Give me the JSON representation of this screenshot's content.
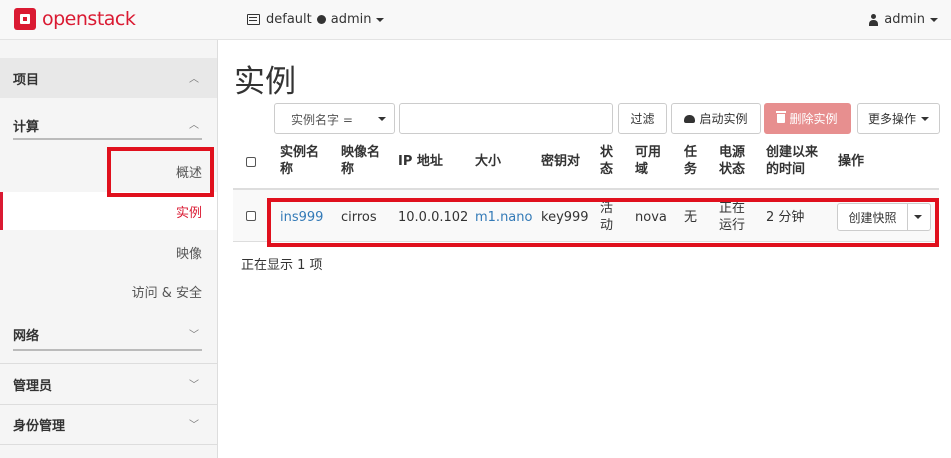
{
  "topbar": {
    "brand": "openstack",
    "domain": "default",
    "project": "admin",
    "user": "admin"
  },
  "sidebar": {
    "project": "项目",
    "compute": "计算",
    "items": [
      "概述",
      "实例",
      "映像",
      "访问 & 安全"
    ],
    "active": "实例",
    "network": "网络",
    "admin": "管理员",
    "identity": "身份管理"
  },
  "main": {
    "title": "实例",
    "filter_select": "实例名字 =",
    "search_value": "",
    "btn_filter": "过滤",
    "btn_launch": "启动实例",
    "btn_delete": "删除实例",
    "btn_more": "更多操作"
  },
  "table": {
    "headers": [
      "实例名称",
      "映像名称",
      "IP 地址",
      "大小",
      "密钥对",
      "状态",
      "可用域",
      "任务",
      "电源状态",
      "创建以来的时间",
      "操作"
    ],
    "rows": [
      {
        "name": "ins999",
        "image": "cirros",
        "ip": "10.0.0.102",
        "size": "m1.nano",
        "keypair": "key999",
        "status": "活动",
        "zone": "nova",
        "task": "无",
        "power": "正在运行",
        "age": "2 分钟",
        "action": "创建快照"
      }
    ],
    "footer": "正在显示 1 项"
  },
  "colors": {
    "brand": "#da1a32",
    "link": "#337ab7",
    "highlight": "#e0101d",
    "danger_disabled": "#e78f8f"
  }
}
